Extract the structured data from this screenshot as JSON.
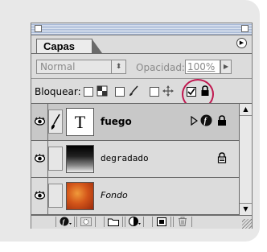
{
  "palette": {
    "tab_label": "Capas",
    "blend_mode": "Normal",
    "opacity_label": "Opacidad:",
    "opacity_value": "100%",
    "lock_label": "Bloquear:"
  },
  "layers": [
    {
      "name": "fuego",
      "thumb_text": "T",
      "type": "text",
      "selected": true
    },
    {
      "name": "degradado",
      "type": "gradient"
    },
    {
      "name": "Fondo",
      "type": "background"
    }
  ],
  "icons": {
    "menu": "menu-arrow-icon",
    "eye": "eye-icon",
    "brush": "brush-icon",
    "lock": "lock-icon",
    "move": "move-icon",
    "effects": "effects-icon",
    "trash": "trash-icon"
  },
  "colors": {
    "highlight_circle": "#c0174f",
    "titlebar_stripes": "#a6b8d6"
  }
}
